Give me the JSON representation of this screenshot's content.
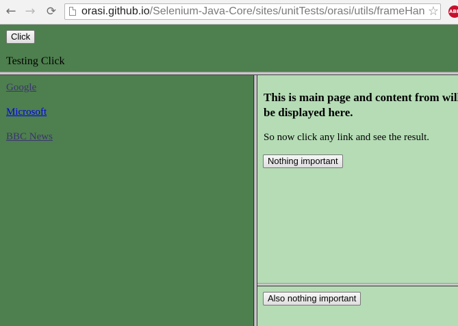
{
  "browser": {
    "url_host": "orasi.github.io",
    "url_path": "/Selenium-Java-Core/sites/unitTests/orasi/utils/frameHan",
    "back_icon": "←",
    "forward_icon": "→",
    "reload_icon": "⟳",
    "star_icon": "☆",
    "extension_label": "ABP"
  },
  "top_frame": {
    "click_button": "Click",
    "status_text": "Testing Click"
  },
  "left_frame": {
    "links": [
      "Google",
      "Microsoft",
      "BBC News"
    ]
  },
  "main_frame": {
    "heading": "This is main page and content from will be displayed here.",
    "paragraph": "So now click any link and see the result.",
    "button": "Nothing important"
  },
  "bottom_frame": {
    "button": "Also nothing important"
  },
  "colors": {
    "frame_green": "#4e7f4e",
    "content_green": "#b5dcb5",
    "link_visited": "#3a3470",
    "link_unvisited": "#0000ee"
  }
}
